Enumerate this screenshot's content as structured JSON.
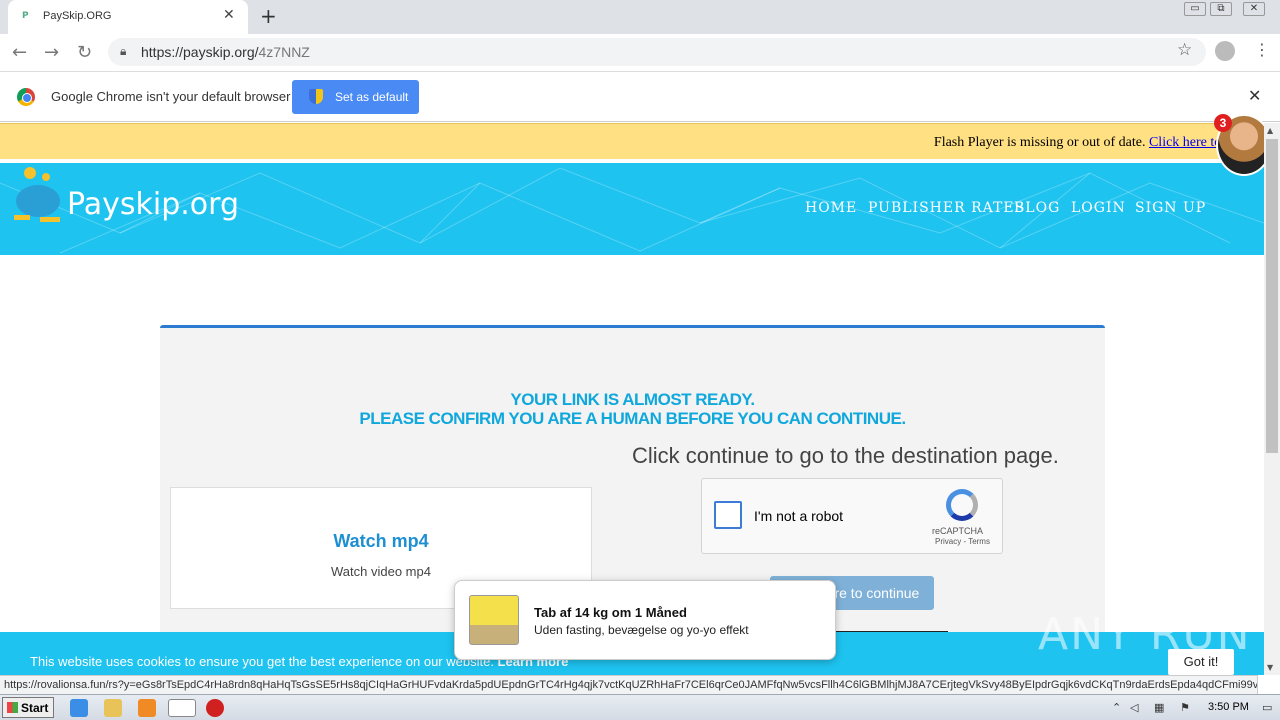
{
  "browser": {
    "tab_title": "PaySkip.ORG",
    "tab_favicon": "P",
    "tab_close": "✕",
    "new_tab": "+",
    "url_host": "https://payskip.org/",
    "url_path": "4z7NNZ",
    "window_controls": [
      "▭",
      "⧉",
      "✕"
    ]
  },
  "infobar": {
    "message": "Google Chrome isn't your default browser",
    "button_label": "Set as default",
    "close": "✕"
  },
  "flash": {
    "message": "Flash Player is missing or out of date. ",
    "link": "Click here to install"
  },
  "site": {
    "logo": "Payskip.org",
    "nav": [
      "HOME",
      "PUBLISHER RATES",
      "BLOG",
      "LOGIN",
      "SIGN UP"
    ],
    "badge_count": "3"
  },
  "card": {
    "headline1": "YOUR LINK IS ALMOST READY.",
    "headline2": "PLEASE CONFIRM YOU ARE A HUMAN BEFORE YOU CAN CONTINUE.",
    "destination_text": "Click continue to go to the destination page.",
    "watch_title": "Watch mp4",
    "watch_sub": "Watch video mp4",
    "captcha_label": "I'm not a robot",
    "captcha_brand": "reCAPTCHA",
    "captcha_links": "Privacy - Terms",
    "continue_label": "Click here to continue"
  },
  "toast": {
    "title": "Tab af 14 kg om 1 Måned",
    "body": "Uden fasting, bevægelse og yo-yo effekt"
  },
  "cookie": {
    "message": "This website uses cookies to ensure you get the best experience on our website. ",
    "learn_more": "Learn more",
    "got_it": "Got it!"
  },
  "watermark": "ANY RUN",
  "status_url": "https://rovalionsa.fun/rs?y=eGs8rTsEpdC4rHa8rdn8qHaHqTsGsSE5rHs8qjCIqHaGrHUFvdaKrda5pdUEpdnGrTC4rHg4qjk7vctKqUZRhHaFr7CEl6qrCe0JAMFfqNw5vcsFllh4C6lGBMlhjMJ8A7CErjtegVkSvy48ByEIpdrGqjk6vdCKqTn9rdaErdsEpda4qdCFmi99vctSgTs8q...",
  "taskbar": {
    "start": "Start",
    "time": "3:50 PM"
  }
}
